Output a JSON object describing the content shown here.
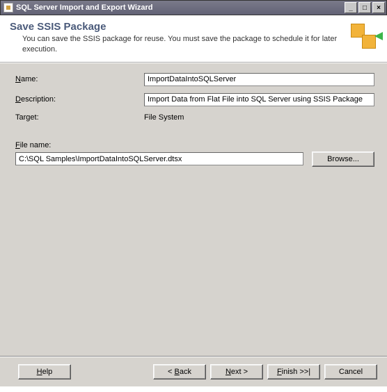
{
  "window": {
    "title": "SQL Server Import and Export Wizard"
  },
  "header": {
    "title": "Save SSIS Package",
    "description": "You can save the SSIS package for reuse. You must save the package to schedule it for later execution."
  },
  "form": {
    "name_label_pre": "N",
    "name_label_post": "ame:",
    "name_value": "ImportDataIntoSQLServer",
    "description_label_pre": "D",
    "description_label_post": "escription:",
    "description_value": "Import Data from Flat File into SQL Server using SSIS Package",
    "target_label": "Target:",
    "target_value": "File System",
    "filename_label_pre": "F",
    "filename_label_post": "ile name:",
    "filename_value": "C:\\SQL Samples\\ImportDataIntoSQLServer.dtsx",
    "browse_label": "Browse..."
  },
  "footer": {
    "help": "Help",
    "back": "< Back",
    "next": "Next >",
    "finish": "Finish >>|",
    "cancel": "Cancel"
  }
}
